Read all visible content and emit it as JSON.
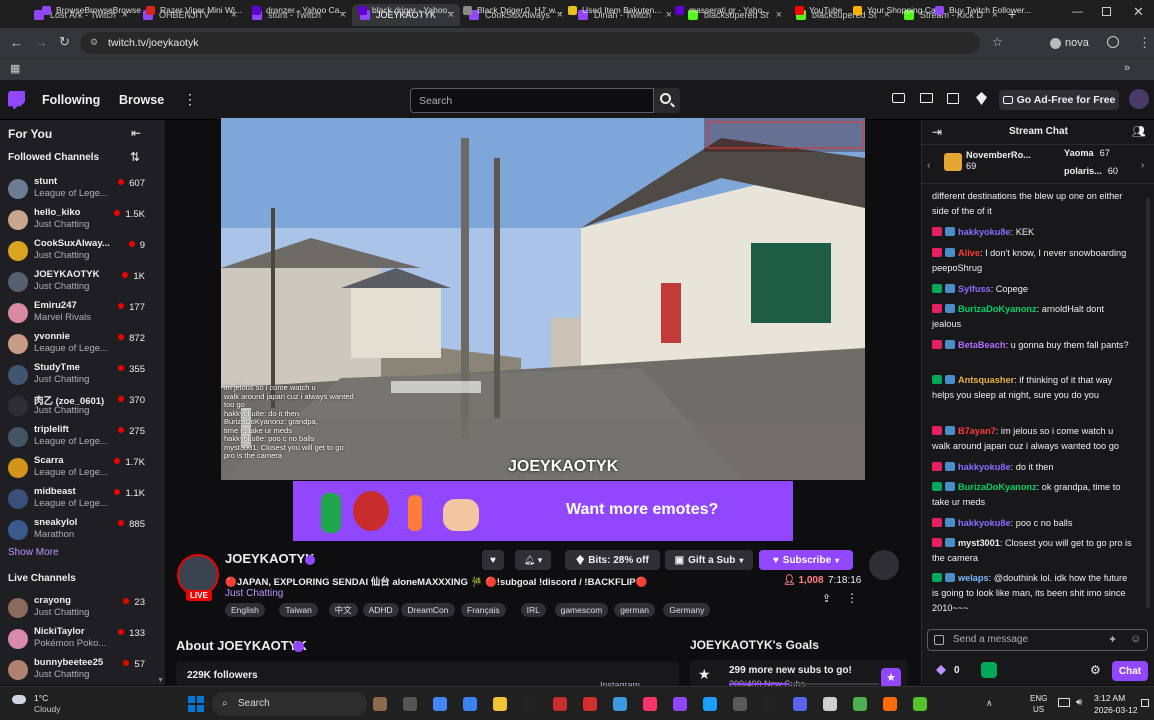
{
  "browser": {
    "tabs": [
      {
        "title": "Lost Ark - Twitch",
        "color": "#9147ff"
      },
      {
        "title": "OHBENJITV",
        "color": "#9147ff"
      },
      {
        "title": "stunt - Twitch",
        "color": "#9147ff"
      },
      {
        "title": "JOEYKAOTYK",
        "color": "#9147ff"
      },
      {
        "title": "CookSuxAlways",
        "color": "#9147ff"
      },
      {
        "title": "Dinah - Twitch",
        "color": "#9147ff"
      },
      {
        "title": "blacksupered St",
        "color": "#53fc18"
      },
      {
        "title": "blacksupered St",
        "color": "#53fc18"
      },
      {
        "title": "Stream - Kick D",
        "color": "#53fc18"
      }
    ],
    "url": "twitch.tv/joeykaotyk",
    "profile": "nova",
    "bookmarks": [
      "BrowseBrowseBrowse",
      "Razer Viper Mini Wi...",
      "dranzer - Yahoo Ca...",
      "black driger - Yahoo...",
      "Black Driger.0. HJ' w...",
      "Used Item Bakuten...",
      "masserati gr - Yaho...",
      "YouTube",
      "Your Shopping Cart",
      "Buy Twitch Follower..."
    ]
  },
  "nav": {
    "following": "Following",
    "browse": "Browse",
    "search_placeholder": "Search",
    "ad_free": "Go Ad-Free for Free"
  },
  "sidebar": {
    "for_you": "For You",
    "followed_header": "Followed Channels",
    "followed": [
      {
        "name": "stunt",
        "game": "League of Lege...",
        "viewers": "607",
        "color": "#6b7c93"
      },
      {
        "name": "hello_kiko",
        "game": "Just Chatting",
        "viewers": "1.5K",
        "color": "#c7a58f"
      },
      {
        "name": "CookSuxAlway...",
        "game": "Just Chatting",
        "viewers": "9",
        "color": "#d9a520"
      },
      {
        "name": "JOEYKAOTYK",
        "game": "Just Chatting",
        "viewers": "1K",
        "color": "#556070"
      },
      {
        "name": "Emiru247",
        "game": "Marvel Rivals",
        "viewers": "177",
        "color": "#d98aa0"
      },
      {
        "name": "yvonnie",
        "game": "League of Lege...",
        "viewers": "872",
        "color": "#c99a84"
      },
      {
        "name": "StudyTme",
        "game": "Just Chatting",
        "viewers": "355",
        "color": "#3f5570"
      },
      {
        "name": "肉乙 (zoe_0601)",
        "game": "Just Chatting",
        "viewers": "370",
        "color": "#2d2d33"
      },
      {
        "name": "triplelift",
        "game": "League of Lege...",
        "viewers": "275",
        "color": "#445566"
      },
      {
        "name": "Scarra",
        "game": "League of Lege...",
        "viewers": "1.7K",
        "color": "#d4941c"
      },
      {
        "name": "midbeast",
        "game": "League of Lege...",
        "viewers": "1.1K",
        "color": "#3a4f7a"
      },
      {
        "name": "sneakylol",
        "game": "Marathon",
        "viewers": "885",
        "color": "#3b5a8c"
      }
    ],
    "show_more": "Show More",
    "live_header": "Live Channels",
    "live": [
      {
        "name": "crayong",
        "game": "Just Chatting",
        "viewers": "23",
        "color": "#8a6a5a"
      },
      {
        "name": "NickiTaylor",
        "game": "Pokémon Poko...",
        "viewers": "133",
        "color": "#d98aa8"
      },
      {
        "name": "bunnybeetee25",
        "game": "Just Chatting",
        "viewers": "57",
        "color": "#b08070"
      }
    ]
  },
  "video": {
    "watermark": "JOEYKAOTYK",
    "overlay_lines": [
      "im jelous so i come watch u",
      "walk around japan cuz i always wanted",
      "too go",
      "hakkyoku8e: do it then",
      "BurizaDoKyanonz: grandpa,",
      "time to take ur meds",
      "hakkyoku8e: poo c no balls",
      "myst3001: Closest you will get to go",
      "pro is the camera"
    ],
    "banner_text": "Want more emotes?"
  },
  "stream": {
    "channel": "JOEYKAOTYK",
    "title": "🔴JAPAN, EXPLORING SENDAI 仙台 aloneMAXXXING 🎋 🔴!subgoal !discord / !BACKFLIP🔴",
    "category": "Just Chatting",
    "live_badge": "LIVE",
    "viewers": "1,008",
    "uptime": "7:18:16",
    "bits_label": "Bits: 28% off",
    "gift_label": "Gift a Sub",
    "subscribe_label": "Subscribe",
    "tags": [
      "English",
      "Taiwan",
      "中文",
      "ADHD",
      "DreamCon",
      "Français",
      "IRL",
      "gamescom",
      "german",
      "Germany"
    ],
    "about_title": "About JOEYKAOTYK",
    "followers": "229K followers",
    "instagram": "Instagram",
    "goals_title": "JOEYKAOTYK's Goals",
    "goal_text": "299 more new subs to go!",
    "goal_progress": "200/499 New Subs",
    "goal_fraction": 0.4
  },
  "chat": {
    "title": "Stream Chat",
    "gifters": [
      {
        "name": "NovemberRo...",
        "count": "69"
      },
      {
        "name": "Yaoma",
        "count": "67"
      },
      {
        "name": "polaris...",
        "count": "60"
      }
    ],
    "messages": [
      {
        "user": "",
        "color": "#efeff1",
        "text": "different destinations the blew up one on either side of the of it"
      },
      {
        "user": "hakkyoku8e",
        "color": "#8a6cff",
        "text": "KEK"
      },
      {
        "user": "Alive",
        "color": "#ff3b3b",
        "text": "I don't know, I never snowboarding peepoShrug"
      },
      {
        "user": "Sylfuss",
        "color": "#8a6cff",
        "text": "Copege"
      },
      {
        "user": "BurizaDoKyanonz",
        "color": "#00d26a",
        "text": "arnoldHalt dont jealous"
      },
      {
        "user": "BetaBeach",
        "color": "#b36cff",
        "text": "u gonna buy them fall pants?"
      },
      {
        "user": "Antsquasher",
        "color": "#e6b33d",
        "text": "if thinking of it that way helps you sleep at night, sure you do you"
      },
      {
        "user": "B7ayan7",
        "color": "#ff3b3b",
        "text": "im jelous so i come watch u walk around japan cuz i always wanted too go"
      },
      {
        "user": "hakkyoku8e",
        "color": "#8a6cff",
        "text": "do it then"
      },
      {
        "user": "BurizaDoKyanonz",
        "color": "#00d26a",
        "text": "ok grandpa, time to take ur meds"
      },
      {
        "user": "hakkyoku8e",
        "color": "#8a6cff",
        "text": "poo c no balls"
      },
      {
        "user": "myst3001",
        "color": "#efeff1",
        "text": "Closest you will get to go pro is the camera"
      },
      {
        "user": "welaps",
        "color": "#7db8ff",
        "text": "@douthink lol. idk how the future is going to look like man, its been shit imo since 2010~~~"
      }
    ],
    "input_placeholder": "Send a message",
    "points": "0",
    "chat_button": "Chat"
  },
  "taskbar": {
    "weather_temp": "1°C",
    "weather_desc": "Cloudy",
    "search": "Search",
    "lang": "ENG",
    "region": "US",
    "time": "3:12 AM",
    "date": "2026-03-12"
  }
}
